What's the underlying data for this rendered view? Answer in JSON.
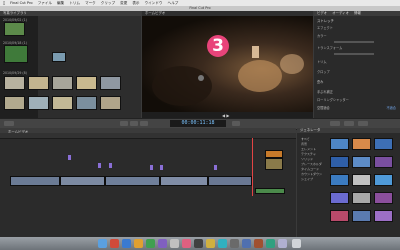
{
  "menubar": {
    "apple": "",
    "items": [
      "Final Cut Pro",
      "ファイル",
      "編集",
      "トリム",
      "マーク",
      "クリップ",
      "変更",
      "表示",
      "ウインドウ",
      "ヘルプ"
    ]
  },
  "window": {
    "title": "Final Cut Pro"
  },
  "library": {
    "title": "写真ライブラリ",
    "events": [
      "2010/09/02 (1)",
      "2010/09/18 (1)",
      "2010/09/29 (8)"
    ]
  },
  "viewer": {
    "title": "ホームビデオ"
  },
  "overlay": {
    "badge_number": "3"
  },
  "inspector": {
    "tabs": [
      "ビデオ",
      "オーディオ",
      "情報"
    ],
    "title": "ストレッチ",
    "rows": [
      "エフェクト",
      "カラー",
      "トランスフォーム",
      "トリム",
      "クロップ",
      "歪み",
      "手ぶれ補正",
      "ローリングシャッター",
      "空間適合"
    ],
    "values": [
      "",
      "",
      "",
      "",
      "",
      "",
      "",
      "",
      "不適合"
    ]
  },
  "toolbar": {
    "timecode": "00:00:11:18"
  },
  "timeline": {
    "title": "ホームビデオ"
  },
  "browser": {
    "title": "ジェネレータ",
    "categories": [
      "すべて",
      "背景",
      "エレメント",
      "テクスチャ",
      "ソリッド",
      "プレースホルダ",
      "タイムコード",
      "カウントダウン",
      "シェイプ"
    ]
  },
  "colors": {
    "accent": "#e8447a",
    "timecode": "#7cc4ff",
    "clip_blue": "#6f7f9a",
    "audio_green": "#4b8a4b",
    "marker_purple": "#8a6fd6"
  }
}
